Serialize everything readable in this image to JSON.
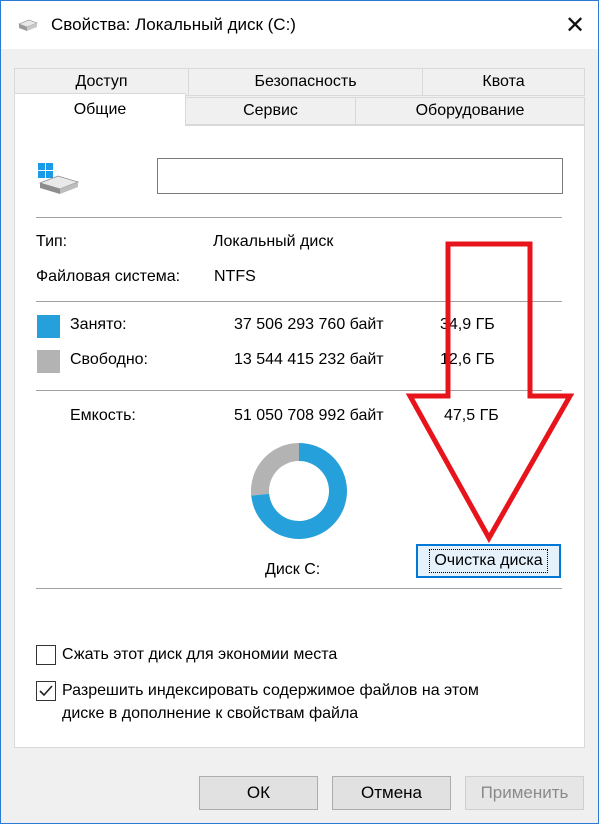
{
  "window": {
    "title": "Свойства: Локальный диск (C:)",
    "close_glyph": "✕"
  },
  "tabs": {
    "row1": [
      "Доступ",
      "Безопасность",
      "Квота"
    ],
    "row2": [
      "Общие",
      "Сервис",
      "Оборудование"
    ],
    "active": "Общие"
  },
  "general": {
    "name_value": "",
    "type_label": "Тип:",
    "type_value": "Локальный диск",
    "fs_label": "Файловая система:",
    "fs_value": "NTFS",
    "used": {
      "label": "Занято:",
      "bytes": "37 506 293 760 байт",
      "gb": "34,9 ГБ",
      "color": "#26a0da"
    },
    "free": {
      "label": "Свободно:",
      "bytes": "13 544 415 232 байт",
      "gb": "12,6 ГБ",
      "color": "#b3b3b3"
    },
    "capacity": {
      "label": "Емкость:",
      "bytes": "51 050 708 992 байт",
      "gb": "47,5 ГБ"
    },
    "disk_label": "Диск C:",
    "cleanup_button": "Очистка диска",
    "donut": {
      "used_fraction": 0.7347
    }
  },
  "options": {
    "compress": {
      "label": "Сжать этот диск для экономии места",
      "checked": false
    },
    "index_line1": "Разрешить индексировать содержимое файлов на этом",
    "index_line2": "диске в дополнение к свойствам файла",
    "index_checked": true
  },
  "buttons": {
    "ok": "ОК",
    "cancel": "Отмена",
    "apply": "Применить"
  },
  "annotation": {
    "arrow_color": "#e8141b"
  }
}
